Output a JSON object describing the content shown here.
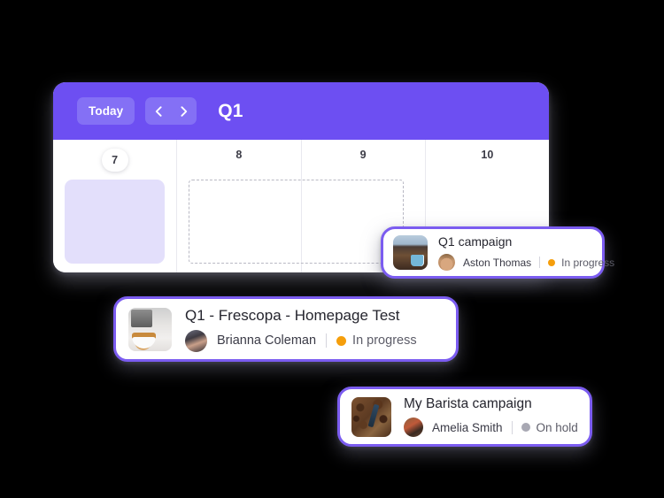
{
  "window": {
    "header": {
      "today_label": "Today",
      "prev_icon": "chevron-left-icon",
      "next_icon": "chevron-right-icon",
      "title": "Q1",
      "background_color": "#6D4FF2",
      "button_color": "#8470F5"
    },
    "calendar": {
      "days": [
        {
          "number": "7",
          "is_today": true,
          "has_event": true,
          "event_color": "#E3DFFB"
        },
        {
          "number": "8",
          "is_today": false,
          "has_event": false,
          "ghost": true
        },
        {
          "number": "9",
          "is_today": false,
          "has_event": false,
          "ghost": false
        },
        {
          "number": "10",
          "is_today": false,
          "has_event": false,
          "ghost": false
        }
      ]
    }
  },
  "cards": [
    {
      "id": "q1-campaign",
      "title": "Q1 campaign",
      "person": "Aston Thomas",
      "status": "In progress",
      "status_color": "#F59E0B",
      "thumbnail": "coffee-mug-landscape-thumbnail",
      "avatar": "aston-thomas-avatar",
      "border_color": "#7B5CF0"
    },
    {
      "id": "frescopa-homepage-test",
      "title": "Q1 - Frescopa - Homepage Test",
      "person": "Brianna Coleman",
      "status": "In progress",
      "status_color": "#F59E0B",
      "thumbnail": "espresso-machine-thumbnail",
      "avatar": "brianna-coleman-avatar",
      "border_color": "#7B5CF0"
    },
    {
      "id": "my-barista-campaign",
      "title": "My Barista campaign",
      "person": "Amelia Smith",
      "status": "On hold",
      "status_color": "#A8A8B3",
      "thumbnail": "coffee-beans-thumbnail",
      "avatar": "amelia-smith-avatar",
      "border_color": "#7B5CF0"
    }
  ]
}
